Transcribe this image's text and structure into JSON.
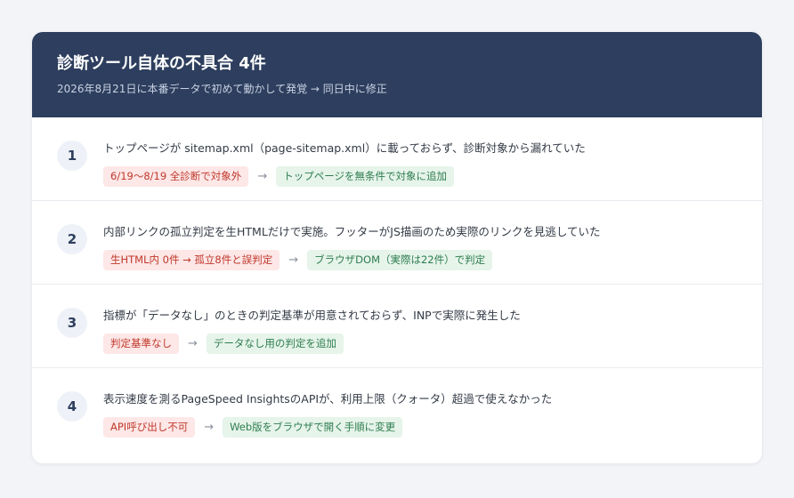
{
  "header": {
    "title": "診断ツール自体の不具合 4件",
    "subtitle": "2026年8月21日に本番データで初めて動かして発覚 → 同日中に修正"
  },
  "arrow": "→",
  "items": [
    {
      "number": "1",
      "title": "トップページが sitemap.xml（page-sitemap.xml）に載っておらず、診断対象から漏れていた",
      "issue": "6/19〜8/19 全診断で対象外",
      "fix": "トップページを無条件で対象に追加"
    },
    {
      "number": "2",
      "title": "内部リンクの孤立判定を生HTMLだけで実施。フッターがJS描画のため実際のリンクを見逃していた",
      "issue": "生HTML内 0件 → 孤立8件と誤判定",
      "fix": "ブラウザDOM（実際は22件）で判定"
    },
    {
      "number": "3",
      "title": "指標が「データなし」のときの判定基準が用意されておらず、INPで実際に発生した",
      "issue": "判定基準なし",
      "fix": "データなし用の判定を追加"
    },
    {
      "number": "4",
      "title": "表示速度を測るPageSpeed InsightsのAPIが、利用上限（クォータ）超過で使えなかった",
      "issue": "API呼び出し不可",
      "fix": "Web版をブラウザで開く手順に変更"
    }
  ],
  "colors": {
    "header_bg": "#2d3e5e",
    "issue_bg": "#fde7e7",
    "issue_text": "#c0392b",
    "fix_bg": "#e6f4ea",
    "fix_text": "#2e7d4f"
  }
}
